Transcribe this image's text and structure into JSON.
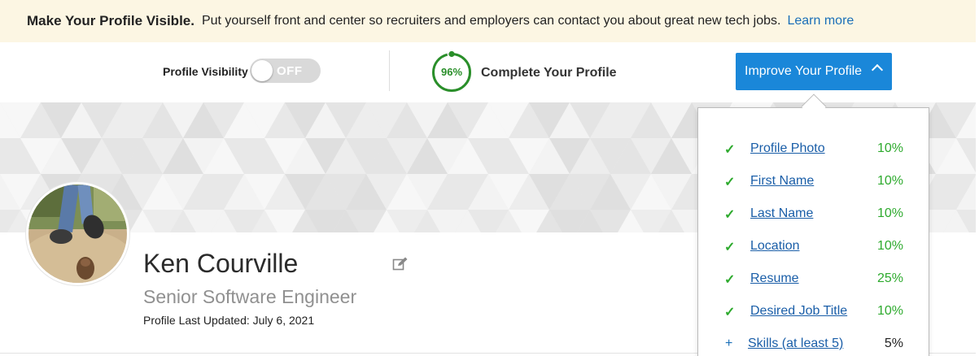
{
  "banner": {
    "headline": "Make Your Profile Visible.",
    "message": "Put yourself front and center so recruiters and employers can contact you about great new tech jobs.",
    "link": "Learn more"
  },
  "status_bar": {
    "visibility_label": "Profile Visibility",
    "visibility_state": "OFF",
    "completion_percent_label": "96%",
    "completion_fraction": 0.96,
    "complete_label": "Complete Your Profile",
    "improve_button": "Improve Your Profile"
  },
  "profile": {
    "name": "Ken Courville",
    "title": "Senior Software Engineer",
    "last_updated": "Profile Last Updated: July 6, 2021"
  },
  "improve_panel": {
    "items": [
      {
        "label": "Profile Photo",
        "value": "10%",
        "done": true,
        "mark": "✓"
      },
      {
        "label": "First Name",
        "value": "10%",
        "done": true,
        "mark": "✓"
      },
      {
        "label": "Last Name",
        "value": "10%",
        "done": true,
        "mark": "✓"
      },
      {
        "label": "Location",
        "value": "10%",
        "done": true,
        "mark": "✓"
      },
      {
        "label": "Resume",
        "value": "25%",
        "done": true,
        "mark": "✓"
      },
      {
        "label": "Desired Job Title",
        "value": "10%",
        "done": true,
        "mark": "✓"
      },
      {
        "label": "Skills (at least 5)",
        "value": "5%",
        "done": false,
        "mark": "+"
      }
    ]
  },
  "colors": {
    "banner_bg": "#fcf6e3",
    "accent_blue": "#1a87d9",
    "link_blue": "#1a6fb8",
    "success_green": "#2eaa2e",
    "toggle_off": "#d9d9d9"
  },
  "icons": [
    "checkmark-icon",
    "plus-icon",
    "chevron-up-icon",
    "edit-icon",
    "progress-ring-icon"
  ]
}
